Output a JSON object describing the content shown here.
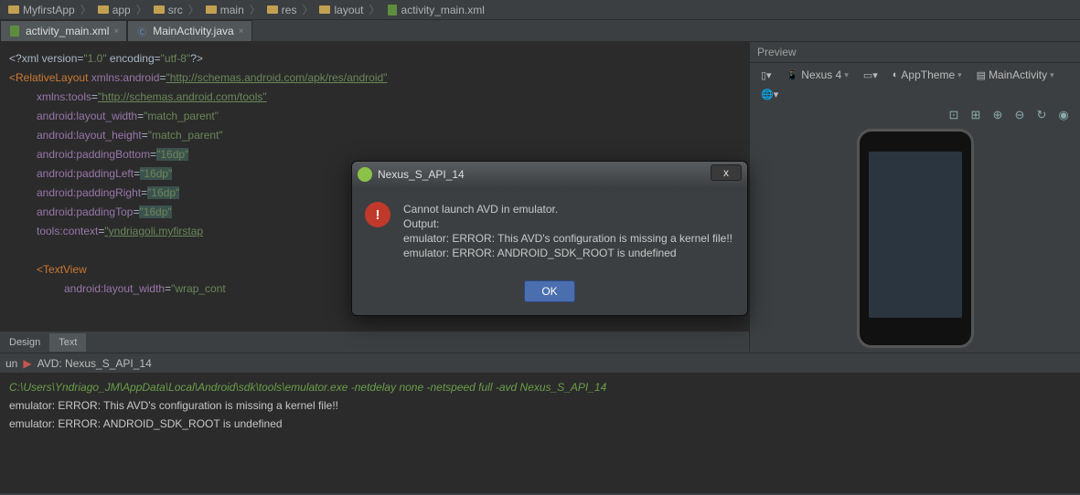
{
  "breadcrumb": [
    "MyfirstApp",
    "app",
    "src",
    "main",
    "res",
    "layout",
    "activity_main.xml"
  ],
  "tabs": [
    {
      "label": "activity_main.xml",
      "type": "xml"
    },
    {
      "label": "MainActivity.java",
      "type": "java"
    }
  ],
  "editor": {
    "l1_pre": "<?",
    "l1_key": "xml version",
    "l1_eq": "=",
    "l1_v1": "\"1.0\"",
    "l1_enc": " encoding",
    "l1_v2": "\"utf-8\"",
    "l1_post": "?>",
    "l2_open": "<",
    "l2_tag": "RelativeLayout ",
    "l2_ns": "xmlns:android",
    "l2_eq": "=",
    "l2_val": "\"http://schemas.android.com/apk/res/android\"",
    "l3_ns": "xmlns:tools",
    "l3_val": "\"http://schemas.android.com/tools\"",
    "l4_a": "android:",
    "l4_k": "layout_width",
    "l4_v": "\"match_parent\"",
    "l5_k": "layout_height",
    "l5_v": "\"match_parent\"",
    "l6_k": "paddingBottom",
    "l6_v": "\"16dp\"",
    "l7_k": "paddingLeft",
    "l7_v": "\"16dp\"",
    "l8_k": "paddingRight",
    "l8_v": "\"16dp\"",
    "l9_k": "paddingTop",
    "l9_v": "\"16dp\"",
    "l10_k": "tools:",
    "l10_k2": "context",
    "l10_v": "\"yndriagoli.myfirstap",
    "l12_open": "<",
    "l12_tag": "TextView",
    "l13_k": "layout_width",
    "l13_v": "\"wrap_cont"
  },
  "design_tabs": {
    "design": "Design",
    "text": "Text"
  },
  "runbar": {
    "label": "AVD: Nexus_S_API_14",
    "prefix": "un"
  },
  "console": {
    "cmd": "C:\\Users\\Yndriago_JM\\AppData\\Local\\Android\\sdk\\tools\\emulator.exe -netdelay none -netspeed full -avd Nexus_S_API_14",
    "e1": "emulator: ERROR: This AVD's configuration is missing a kernel file!!",
    "e2": "emulator: ERROR: ANDROID_SDK_ROOT is undefined"
  },
  "preview": {
    "title": "Preview",
    "device": "Nexus 4",
    "theme": "AppTheme",
    "activity": "MainActivity"
  },
  "dialog": {
    "title": "Nexus_S_API_14",
    "l1": "Cannot launch AVD in emulator.",
    "l2": "Output:",
    "l3": "emulator: ERROR: This AVD's configuration is missing a kernel file!!",
    "l4": "emulator: ERROR: ANDROID_SDK_ROOT is undefined",
    "ok": "OK"
  }
}
